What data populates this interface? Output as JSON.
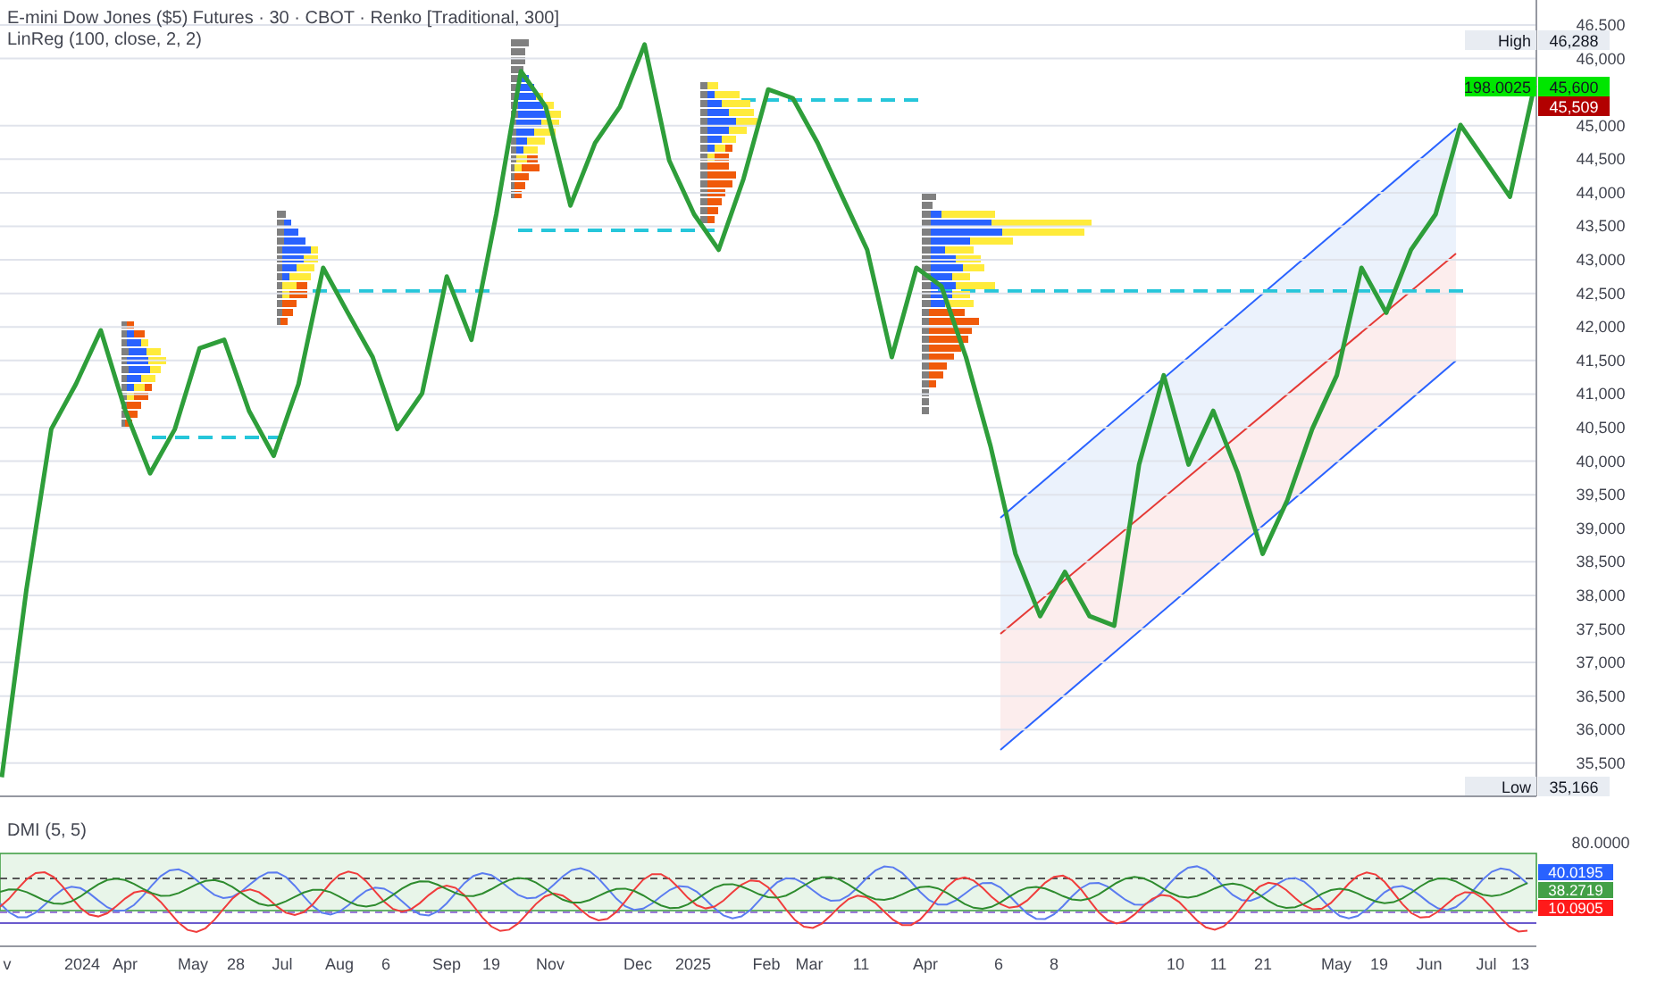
{
  "header": {
    "title": "E-mini Dow Jones ($5) Futures · 30 · CBOT · Renko [Traditional, 300]",
    "indicator": "LinReg (100, close, 2, 2)"
  },
  "chart_data": {
    "type": "line",
    "ylim": [
      35006,
      46872
    ],
    "grid": true,
    "categories": [
      null,
      null,
      null,
      null,
      null,
      null,
      null,
      null,
      null,
      null,
      null,
      null,
      null,
      null,
      null,
      null,
      null,
      null,
      null,
      null,
      null,
      null,
      null,
      null,
      null,
      null,
      null,
      null,
      null,
      null,
      null,
      null,
      null,
      null,
      null,
      null,
      null,
      null,
      null,
      null,
      null,
      null,
      null,
      null,
      null,
      null,
      null,
      null,
      null,
      null,
      null,
      null,
      null,
      null,
      null,
      null,
      null,
      null,
      null,
      null,
      null,
      null,
      null
    ],
    "series": [
      {
        "color": "#2e9e3a",
        "values": [
          35290,
          38090,
          40480,
          41150,
          41950,
          40750,
          39820,
          40480,
          41680,
          41810,
          40750,
          40080,
          41150,
          42880,
          42210,
          41550,
          40480,
          41010,
          42750,
          41810,
          43680,
          45810,
          45280,
          43810,
          44740,
          45280,
          46210,
          44480,
          43680,
          43150,
          44210,
          45540,
          45410,
          44740,
          43940,
          43150,
          41550,
          42880,
          42610,
          41550,
          40220,
          38620,
          37690,
          38350,
          37690,
          37550,
          39950,
          41280,
          39950,
          40750,
          39820,
          38620,
          39420,
          40480,
          41280,
          42880,
          42210,
          43150,
          43680,
          45010,
          44480,
          43940,
          45600
        ]
      }
    ],
    "yticks": [
      {
        "value": 35500,
        "label": "35,500"
      },
      {
        "value": 36000,
        "label": "36,000"
      },
      {
        "value": 36500,
        "label": "36,500"
      },
      {
        "value": 37000,
        "label": "37,000"
      },
      {
        "value": 37500,
        "label": "37,500"
      },
      {
        "value": 38000,
        "label": "38,000"
      },
      {
        "value": 38500,
        "label": "38,500"
      },
      {
        "value": 39000,
        "label": "39,000"
      },
      {
        "value": 39500,
        "label": "39,500"
      },
      {
        "value": 40000,
        "label": "40,000"
      },
      {
        "value": 40500,
        "label": "40,500"
      },
      {
        "value": 41000,
        "label": "41,000"
      },
      {
        "value": 41500,
        "label": "41,500"
      },
      {
        "value": 42000,
        "label": "42,000"
      },
      {
        "value": 42500,
        "label": "42,500"
      },
      {
        "value": 43000,
        "label": "43,000"
      },
      {
        "value": 43500,
        "label": "43,500"
      },
      {
        "value": 44000,
        "label": "44,000"
      },
      {
        "value": 44500,
        "label": "44,500"
      },
      {
        "value": 45000,
        "label": "45,000"
      },
      {
        "value": 46000,
        "label": "46,000"
      },
      {
        "value": 46500,
        "label": "46,500"
      }
    ]
  },
  "price_labels": [
    {
      "kind": "high",
      "caption": "High",
      "value": "46,288"
    },
    {
      "kind": "last",
      "caption": "198.0025",
      "value": "45,600"
    },
    {
      "kind": "prev",
      "value": "45,509"
    },
    {
      "kind": "low",
      "caption": "Low",
      "value": "35,166"
    }
  ],
  "dmi": {
    "title": "DMI (5, 5)",
    "axis_label": "80.0000",
    "values": [
      {
        "value": "40.0195",
        "color": "#2962ff"
      },
      {
        "value": "38.2719",
        "color": "#43a047"
      },
      {
        "value": "10.0905",
        "color": "#ff1a1a"
      }
    ]
  },
  "time_axis": [
    "v",
    "2024",
    "Apr",
    "May",
    "28",
    "Jul",
    "Aug",
    "6",
    "Sep",
    "19",
    "Nov",
    "Dec",
    "2025",
    "Feb",
    "Mar",
    "11",
    "Apr",
    "6",
    "8",
    "10",
    "11",
    "21",
    "May",
    "19",
    "Jun",
    "Jul",
    "13"
  ]
}
